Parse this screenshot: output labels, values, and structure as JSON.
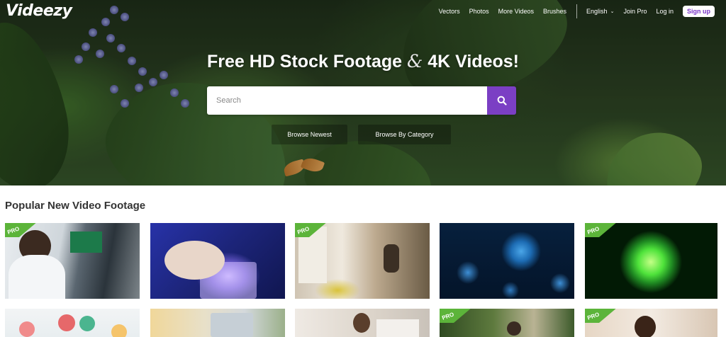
{
  "header": {
    "logo": "Videezy",
    "nav": {
      "vectors": "Vectors",
      "photos": "Photos",
      "more_videos": "More Videos",
      "brushes": "Brushes",
      "language": "English",
      "join_pro": "Join Pro",
      "login": "Log in",
      "signup": "Sign up"
    }
  },
  "hero": {
    "headline_part1": "Free HD Stock Footage",
    "headline_amp": "&",
    "headline_part2": "4K Videos!",
    "search_placeholder": "Search",
    "search_icon": "search-icon",
    "browse_newest": "Browse Newest",
    "browse_category": "Browse By Category"
  },
  "section": {
    "title": "Popular New Video Footage"
  },
  "badge": {
    "label": "PRO",
    "color": "#5cb43a"
  },
  "colors": {
    "accent": "#7b3fc4",
    "signup_text": "#7a35c8"
  }
}
